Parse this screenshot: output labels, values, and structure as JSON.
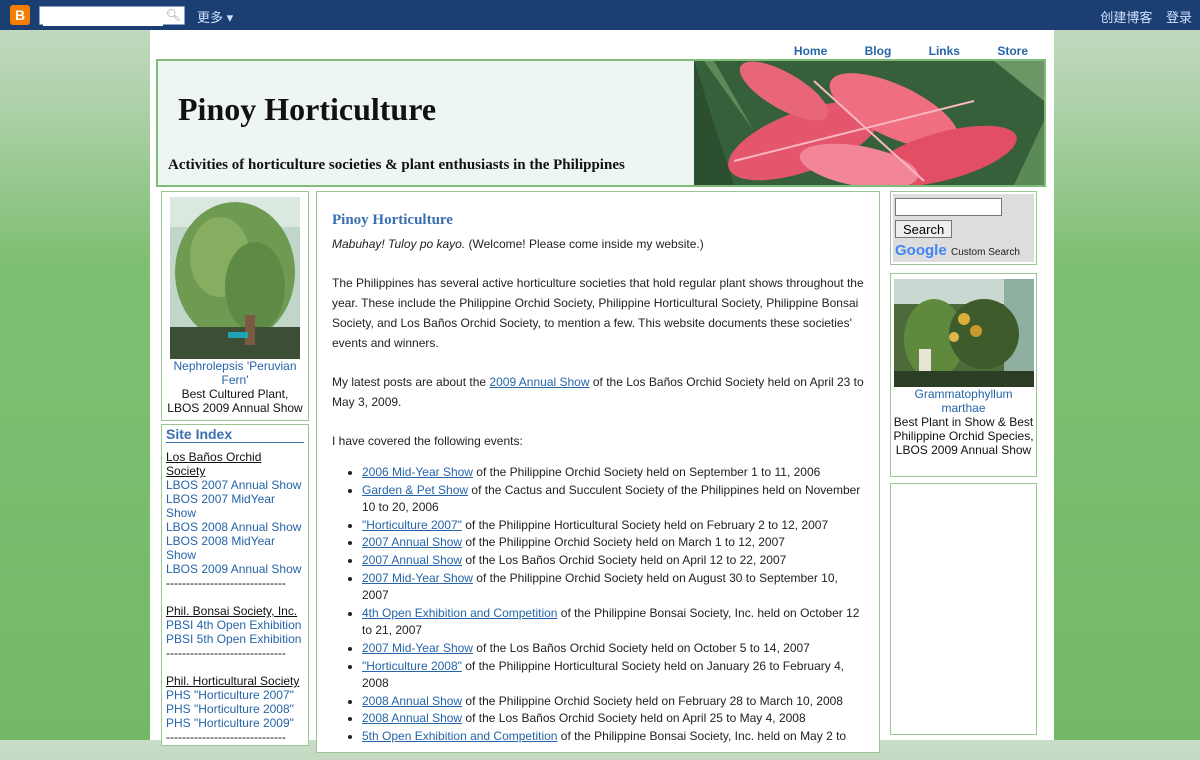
{
  "navbar": {
    "more_label": "更多",
    "create_blog": "创建博客",
    "login": "登录",
    "search_placeholder": ""
  },
  "topnav": {
    "items": [
      "Home",
      "Blog",
      "Links",
      "Store"
    ]
  },
  "header": {
    "title": "Pinoy Horticulture",
    "description": "Activities of horticulture societies & plant enthusiasts in the Philippines"
  },
  "left_photo": {
    "caption_link": "Nephrolepsis 'Peruvian Fern'",
    "caption_line1": "Best Cultured Plant,",
    "caption_line2": "LBOS 2009 Annual Show"
  },
  "site_index": {
    "heading": "Site Index",
    "groups": [
      {
        "title": "Los Baños Orchid Society",
        "links": [
          "LBOS 2007 Annual Show",
          "LBOS 2007 MidYear Show",
          "LBOS 2008 Annual Show",
          "LBOS 2008 MidYear Show",
          "LBOS 2009 Annual Show"
        ]
      },
      {
        "title": "Phil. Bonsai Society, Inc.",
        "links": [
          "PBSI 4th Open Exhibition",
          "PBSI 5th Open Exhibition"
        ]
      },
      {
        "title": "Phil. Horticultural Society",
        "links": [
          "PHS \"Horticulture 2007\"",
          "PHS \"Horticulture 2008\"",
          "PHS \"Horticulture 2009\""
        ]
      }
    ],
    "separator": "------------------------------"
  },
  "main": {
    "post_title": "Pinoy Horticulture",
    "welcome_italic": "Mabuhay! Tuloy po kayo.",
    "welcome_rest": " (Welcome! Please come inside my website.)",
    "para1": "The Philippines has several active horticulture societies that hold regular plant shows throughout the year. These include the Philippine Orchid Society, Philippine Horticultural Society, Philippine Bonsai Society, and Los Baños Orchid Society, to mention a few. This website documents these societies' events and winners.",
    "para2_pre": "My latest posts are about the ",
    "para2_link": "2009 Annual Show",
    "para2_post": " of the Los Baños Orchid Society held on April 23 to May 3, 2009.",
    "para3": "I have covered the following events:",
    "events": [
      {
        "link": "2006 Mid-Year Show",
        "text": " of the Philippine Orchid Society held on September 1 to 11, 2006"
      },
      {
        "link": "Garden & Pet Show",
        "text": " of the Cactus and Succulent Society of the Philippines held on November 10 to 20, 2006"
      },
      {
        "link": "\"Horticulture 2007\"",
        "text": " of the Philippine Horticultural Society held on February 2 to 12, 2007"
      },
      {
        "link": "2007 Annual Show",
        "text": " of the Philippine Orchid Society held on March 1 to 12, 2007"
      },
      {
        "link": "2007 Annual Show",
        "text": " of the Los Baños Orchid Society held on April 12 to 22, 2007"
      },
      {
        "link": "2007 Mid-Year Show",
        "text": " of the Philippine Orchid Society held on August 30 to September 10, 2007"
      },
      {
        "link": "4th Open Exhibition and Competition",
        "text": " of the Philippine Bonsai Society, Inc. held on October 12 to 21, 2007"
      },
      {
        "link": "2007 Mid-Year Show",
        "text": " of the Los Baños Orchid Society held on October 5 to 14, 2007"
      },
      {
        "link": "\"Horticulture 2008\"",
        "text": " of the Philippine Horticultural Society held on January 26 to February 4, 2008"
      },
      {
        "link": "2008 Annual Show",
        "text": " of the Philippine Orchid Society held on February 28 to March 10, 2008"
      },
      {
        "link": "2008 Annual Show",
        "text": " of the Los Baños Orchid Society held on April 25 to May 4, 2008"
      },
      {
        "link": "5th Open Exhibition and Competition",
        "text": " of the Philippine Bonsai Society, Inc. held on May 2 to"
      }
    ]
  },
  "right_search": {
    "button_label": "Search",
    "google_label": "Google",
    "custom_search": "Custom Search"
  },
  "right_photo": {
    "caption_link": "Grammatophyllum marthae",
    "caption_text": "Best Plant in Show & Best Philippine Orchid Species, LBOS 2009 Annual Show"
  },
  "colors": {
    "navbar_bg": "#1c3f73",
    "link": "#2565a8",
    "border_green": "#80bb7a",
    "heading_blue": "#3a6fb0"
  }
}
